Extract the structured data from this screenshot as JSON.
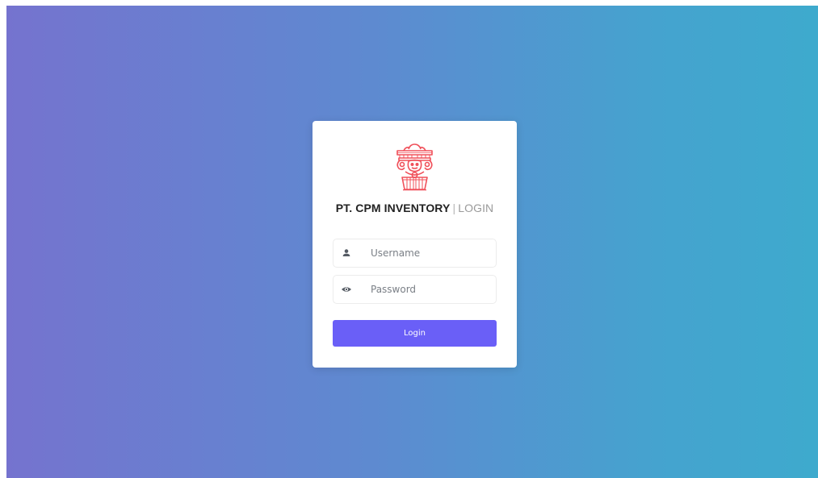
{
  "page": {
    "background_gradient": [
      "#7573cf",
      "#3eaacd"
    ]
  },
  "card": {
    "logo_icon": "ashoka-pillar-emblem-icon",
    "logo_color": "#f0505a",
    "title_brand": "PT. CPM INVENTORY",
    "title_separator": "|",
    "title_suffix": "LOGIN",
    "username": {
      "icon": "user-icon",
      "value": "",
      "placeholder": "Username"
    },
    "password": {
      "icon": "eye-icon",
      "value": "",
      "placeholder": "Password"
    },
    "login_button_label": "Login",
    "button_color": "#6a5ff7"
  }
}
